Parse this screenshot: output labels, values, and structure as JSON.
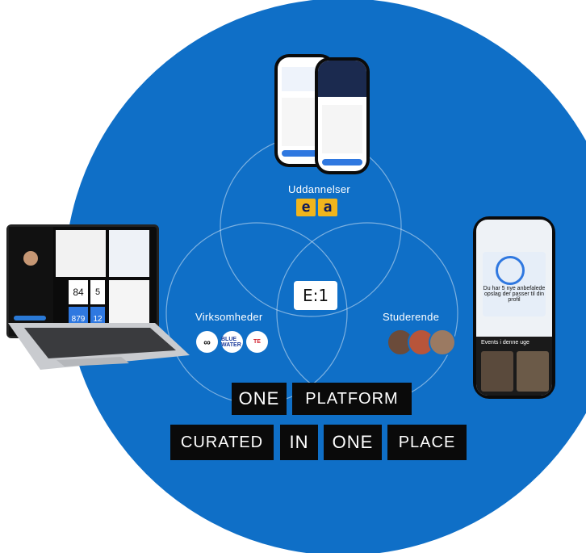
{
  "venn": {
    "top_label": "Uddannelser",
    "left_label": "Virksomheder",
    "right_label": "Studerende",
    "center_logo": "E:1"
  },
  "logos": {
    "ea": [
      "e",
      "a"
    ],
    "companies": [
      "",
      "BLUE WATER",
      "TE"
    ]
  },
  "tagline": {
    "row1": [
      "ONE",
      "PLATFORM"
    ],
    "row2": [
      "CURATED",
      "IN",
      "ONE",
      "PLACE"
    ]
  },
  "devices": {
    "laptop_stats": [
      "84",
      "5",
      "879",
      "12"
    ],
    "phone_right_heading": "Du har 5 nye anbefalede opslag der passer til din profil",
    "phone_right_events": "Events i denne uge"
  },
  "colors": {
    "circle": "#0f6fc7",
    "tag_bg": "#0a0a0a",
    "ea_yellow": "#f1b51c"
  }
}
